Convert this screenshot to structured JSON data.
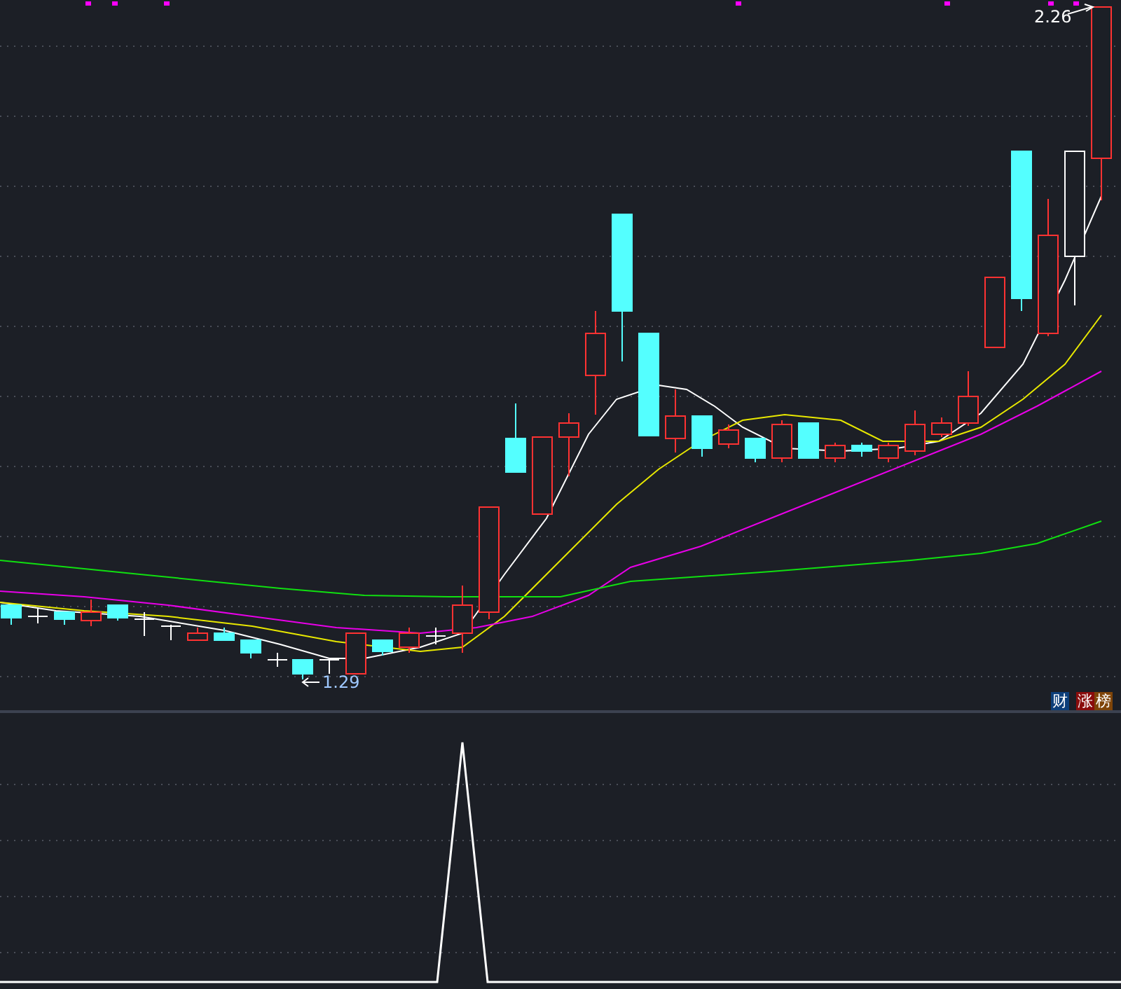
{
  "chart": {
    "high_label": "2.26",
    "low_label": "1.29"
  },
  "badges": [
    {
      "text": "财",
      "color": "#0d3f7a"
    },
    {
      "text": "涨",
      "color": "#8a0c0c"
    },
    {
      "text": "榜",
      "color": "#7e4408"
    }
  ]
}
